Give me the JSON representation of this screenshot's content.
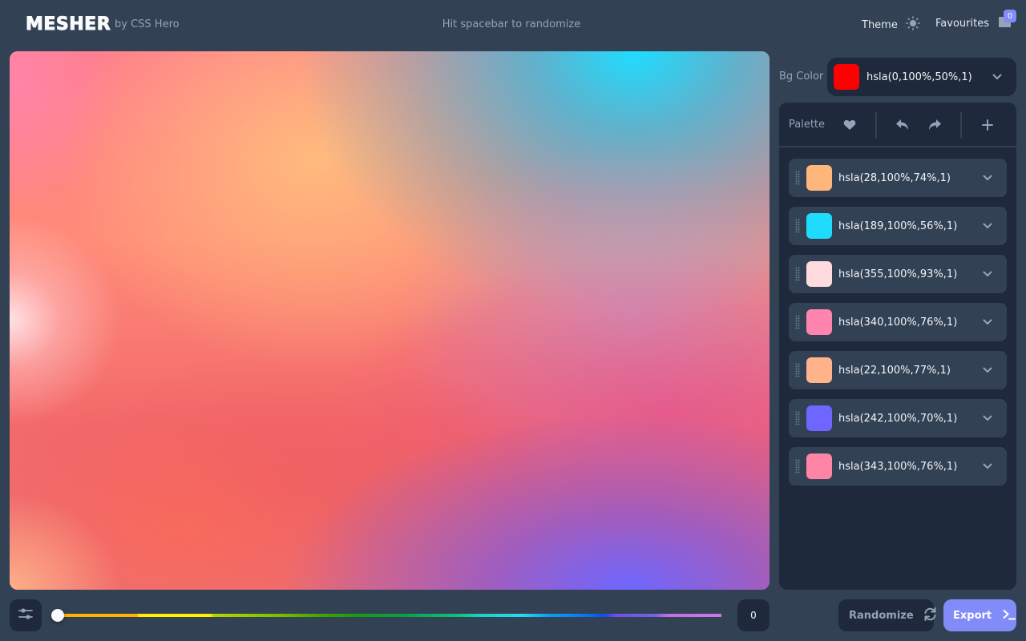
{
  "header": {
    "logo": "MESHER",
    "byline": "by CSS Hero",
    "hint": "Hit spacebar to randomize",
    "theme_label": "Theme",
    "theme_icon": "sun-icon",
    "favourites_label": "Favourites",
    "favourites_icon": "folder-icon",
    "favourites_count": "0"
  },
  "background": {
    "label": "Bg Color",
    "value": "hsla(0,100%,50%,1)",
    "color": "#ff0000"
  },
  "palette": {
    "title": "Palette",
    "toolbar_icons": [
      "heart-icon",
      "undo-icon",
      "redo-icon",
      "plus-icon"
    ],
    "colors": [
      {
        "value": "hsla(28,100%,74%,1)",
        "color": "#ffb67a"
      },
      {
        "value": "hsla(189,100%,56%,1)",
        "color": "#1fdcff"
      },
      {
        "value": "hsla(355,100%,93%,1)",
        "color": "#ffdbde"
      },
      {
        "value": "hsla(340,100%,76%,1)",
        "color": "#ff85ae"
      },
      {
        "value": "hsla(22,100%,77%,1)",
        "color": "#ffb38a"
      },
      {
        "value": "hsla(242,100%,70%,1)",
        "color": "#6e66ff"
      },
      {
        "value": "hsla(343,100%,76%,1)",
        "color": "#ff85a7"
      }
    ]
  },
  "controls": {
    "settings_icon": "sliders-icon",
    "hue_slider_value": 0,
    "hue_value_display": "0",
    "randomize_label": "Randomize",
    "randomize_icon": "refresh-icon",
    "export_label": "Export",
    "export_icon": "terminal-icon"
  },
  "theme_colors": {
    "app_bg": "#334155",
    "panel_bg": "#1e293b",
    "accent": "#818cf8",
    "muted_text": "#94a3b8"
  }
}
